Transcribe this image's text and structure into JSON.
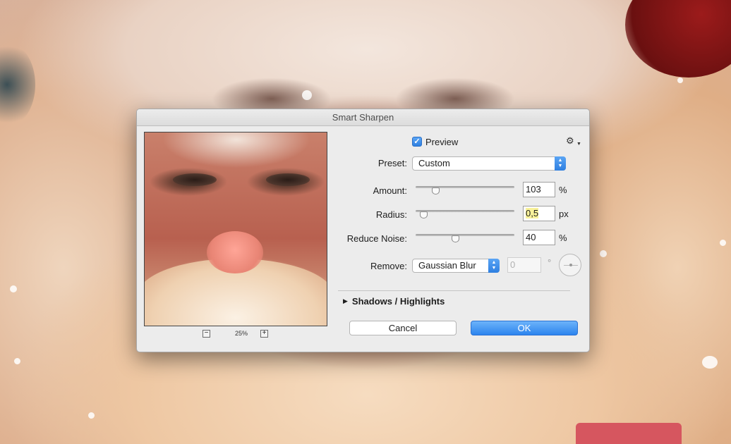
{
  "dialog": {
    "title": "Smart Sharpen",
    "preview_label": "Preview",
    "preview_checked": true,
    "zoom": {
      "minus": "−",
      "level": "25%",
      "plus": "+"
    },
    "preset": {
      "label": "Preset:",
      "value": "Custom"
    },
    "amount": {
      "label": "Amount:",
      "value": "103",
      "unit": "%",
      "slider_fraction": 0.2
    },
    "radius": {
      "label": "Radius:",
      "value": "0,5",
      "unit": "px",
      "slider_fraction": 0.08
    },
    "reduce_noise": {
      "label": "Reduce Noise:",
      "value": "40",
      "unit": "%",
      "slider_fraction": 0.4
    },
    "remove": {
      "label": "Remove:",
      "value": "Gaussian Blur",
      "angle_value": "0",
      "angle_unit": "°"
    },
    "shadows_highlights_label": "Shadows / Highlights",
    "cancel_label": "Cancel",
    "ok_label": "OK"
  },
  "colors": {
    "accent": "#2f7fe0",
    "highlight": "#f9f29a"
  },
  "icons": {
    "settings": "gear-icon",
    "disclosure": "triangle-right-icon",
    "stepper": "up-down-chevron-icon"
  }
}
